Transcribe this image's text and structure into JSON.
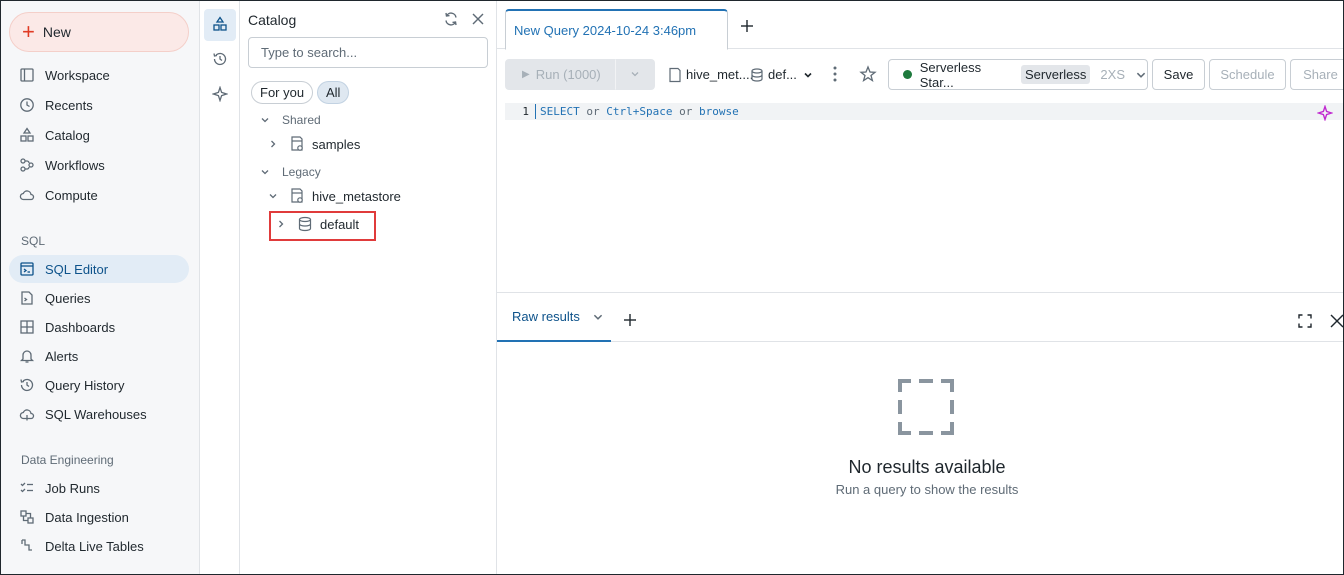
{
  "leftnav": {
    "new_label": "New",
    "items": [
      {
        "label": "Workspace",
        "icon": "workspace-icon"
      },
      {
        "label": "Recents",
        "icon": "clock-icon"
      },
      {
        "label": "Catalog",
        "icon": "catalog-icon"
      },
      {
        "label": "Workflows",
        "icon": "workflows-icon"
      },
      {
        "label": "Compute",
        "icon": "cloud-icon"
      }
    ],
    "sql_section": "SQL",
    "sql_items": [
      {
        "label": "SQL Editor",
        "icon": "sql-editor-icon",
        "active": true
      },
      {
        "label": "Queries",
        "icon": "queries-icon"
      },
      {
        "label": "Dashboards",
        "icon": "dashboards-icon"
      },
      {
        "label": "Alerts",
        "icon": "bell-icon"
      },
      {
        "label": "Query History",
        "icon": "history-icon"
      },
      {
        "label": "SQL Warehouses",
        "icon": "warehouse-icon"
      }
    ],
    "de_section": "Data Engineering",
    "de_items": [
      {
        "label": "Job Runs",
        "icon": "job-runs-icon"
      },
      {
        "label": "Data Ingestion",
        "icon": "ingestion-icon"
      },
      {
        "label": "Delta Live Tables",
        "icon": "delta-icon"
      }
    ]
  },
  "catalog": {
    "title": "Catalog",
    "search_placeholder": "Type to search...",
    "filters": [
      "For you",
      "All"
    ],
    "active_filter": "All",
    "sections": [
      {
        "label": "Shared",
        "nodes": [
          {
            "label": "samples"
          }
        ]
      },
      {
        "label": "Legacy",
        "nodes": [
          {
            "label": "hive_metastore",
            "children": [
              {
                "label": "default"
              }
            ]
          }
        ]
      }
    ]
  },
  "editor": {
    "tab_title": "New Query 2024-10-24 3:46pm",
    "run_label": "Run (1000)",
    "catalog_ctx": "hive_met....",
    "schema_ctx": "def...",
    "warehouse_name": "Serverless Star...",
    "warehouse_tag": "Serverless",
    "warehouse_size": "2XS",
    "save_label": "Save",
    "schedule_label": "Schedule",
    "share_label": "Share",
    "line_number": "1",
    "code_select": "SELECT",
    "code_or1": "or",
    "code_shortcut": "Ctrl+Space",
    "code_or2": "or",
    "code_browse": "browse"
  },
  "results": {
    "tab_label": "Raw results",
    "empty_title": "No results available",
    "empty_subtitle": "Run a query to show the results"
  },
  "colors": {
    "accent": "#2272b4",
    "new_button_bg": "#fbe9e7",
    "highlight_box": "#e03b3b",
    "status_running": "#1e7a3d"
  }
}
